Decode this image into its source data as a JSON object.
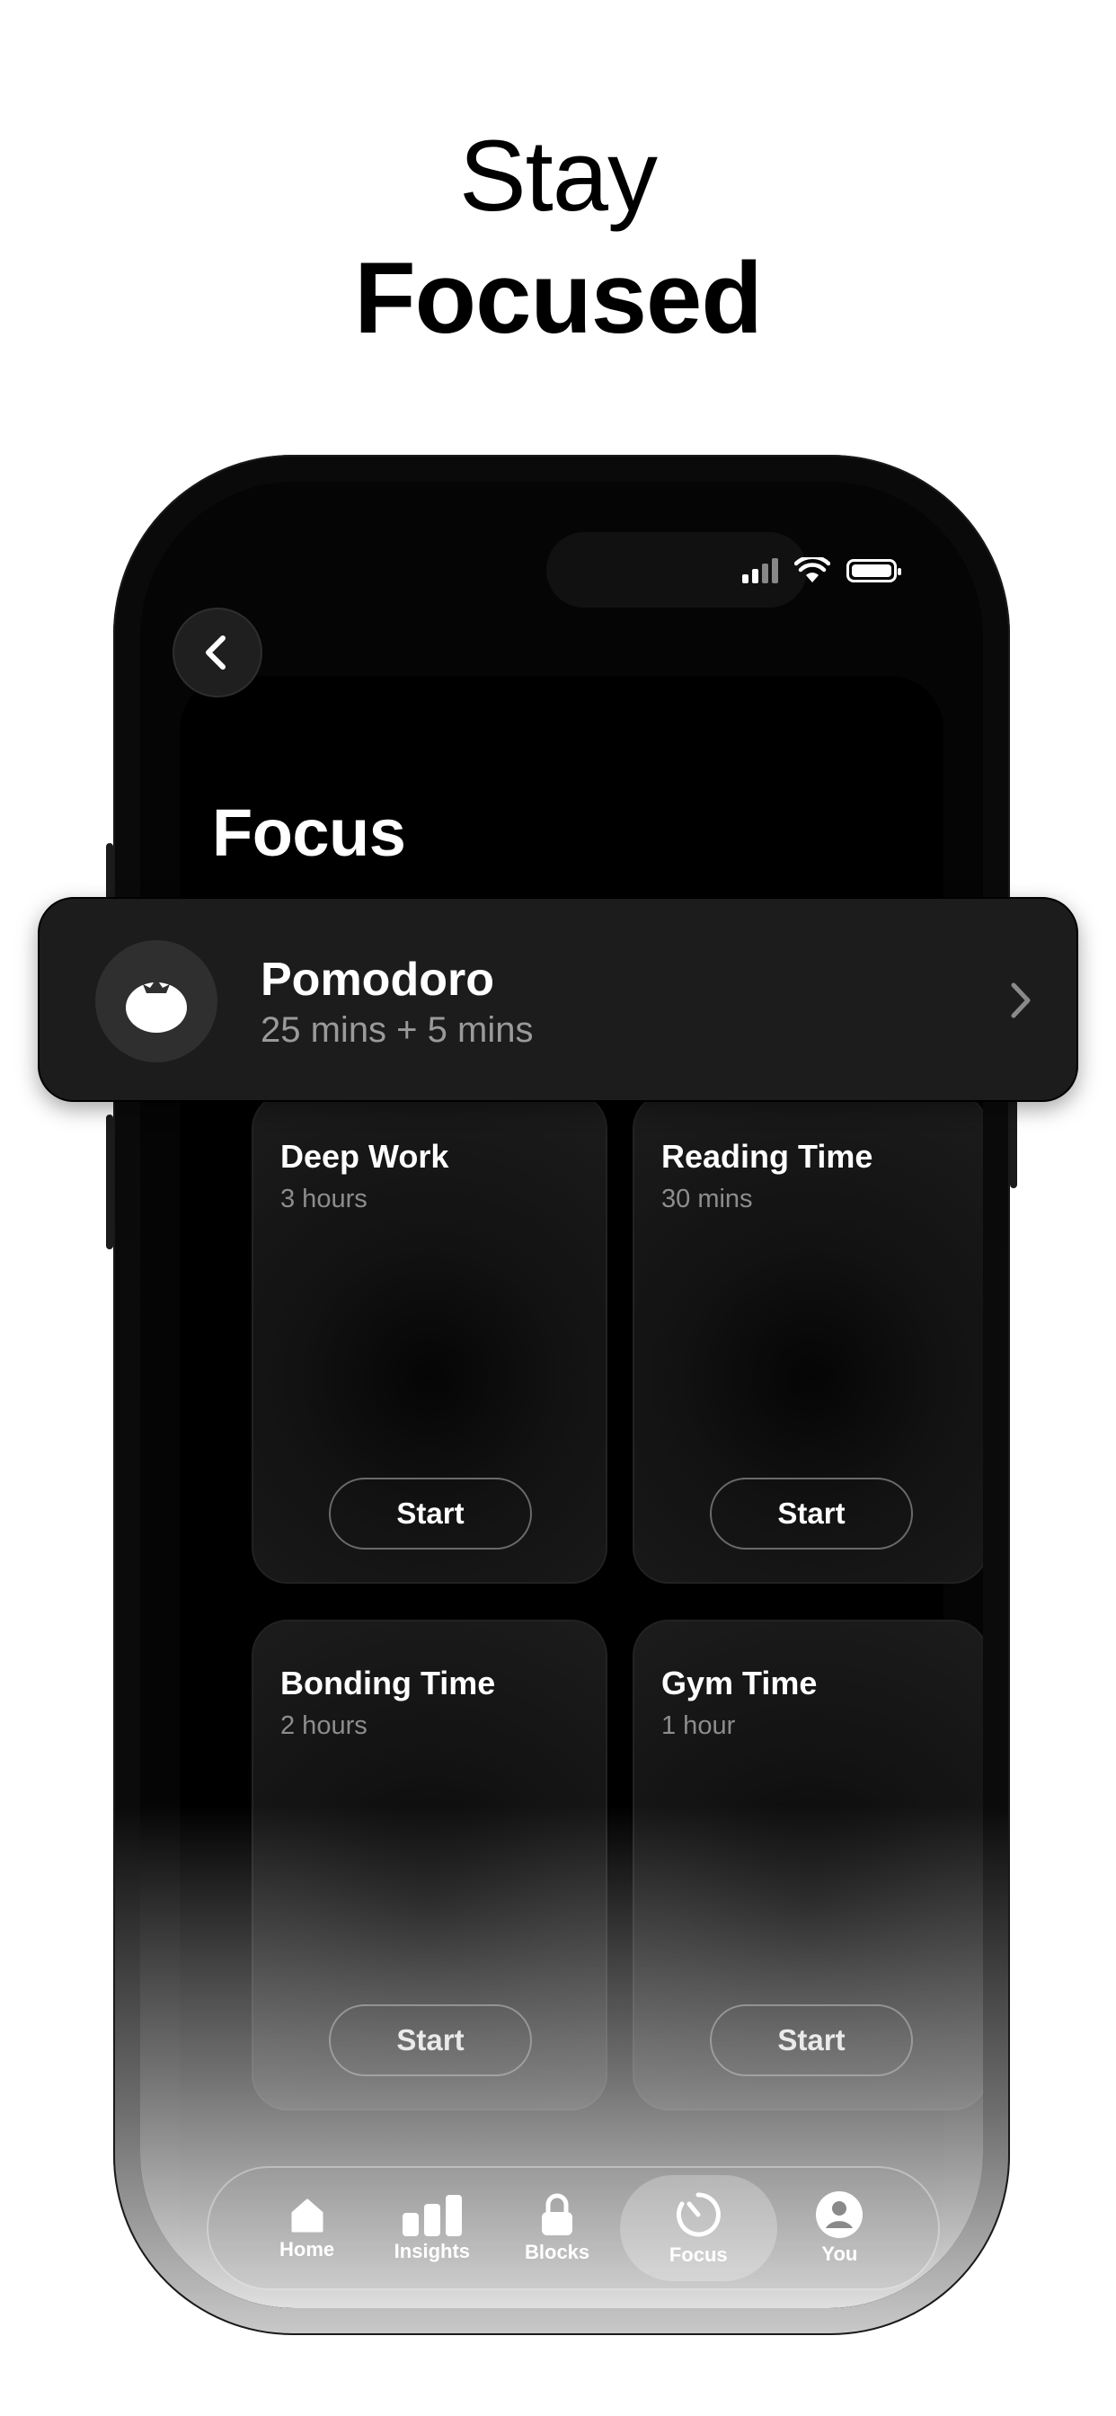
{
  "headline": {
    "line1": "Stay",
    "line2": "Focused"
  },
  "screen": {
    "title": "Focus"
  },
  "featured": {
    "name": "Pomodoro",
    "detail": "25 mins + 5 mins"
  },
  "cards": [
    {
      "title": "Deep Work",
      "duration": "3 hours",
      "action": "Start"
    },
    {
      "title": "Reading Time",
      "duration": "30 mins",
      "action": "Start"
    },
    {
      "title": "Bonding Time",
      "duration": "2 hours",
      "action": "Start"
    },
    {
      "title": "Gym Time",
      "duration": "1 hour",
      "action": "Start"
    }
  ],
  "tabs": [
    {
      "label": "Home",
      "icon": "home-icon"
    },
    {
      "label": "Insights",
      "icon": "bar-chart-icon"
    },
    {
      "label": "Blocks",
      "icon": "lock-icon"
    },
    {
      "label": "Focus",
      "icon": "timer-icon",
      "active": true
    },
    {
      "label": "You",
      "icon": "person-icon"
    }
  ],
  "colors": {
    "accent": "#ffffff",
    "card": "#1c1c1c",
    "muted": "#8d8d8d"
  }
}
